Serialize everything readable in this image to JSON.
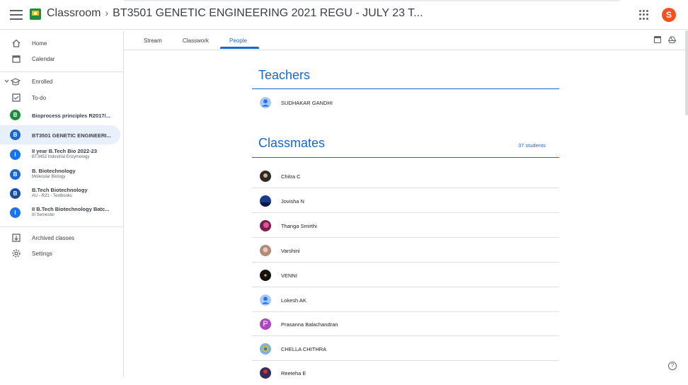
{
  "header": {
    "app_name": "Classroom",
    "separator": "›",
    "class_title": "BT3501 GENETIC ENGINEERING 2021 REGU - JULY 23 T...",
    "account_initial": "S"
  },
  "sidebar": {
    "home": "Home",
    "calendar": "Calendar",
    "enrolled": "Enrolled",
    "todo": "To-do",
    "classes": [
      {
        "initial": "B",
        "title": "Bioprocess principles R2017/...",
        "subtitle": "",
        "color": "#1e8e3e"
      },
      {
        "initial": "B",
        "title": "BT3501 GENETIC ENGINEERI...",
        "subtitle": "",
        "color": "#1967d2",
        "active": true
      },
      {
        "initial": "I",
        "title": "II year B.Tech Bio 2022-23",
        "subtitle": "BT3452 Industrial Enzymology",
        "color": "#1a73e8"
      },
      {
        "initial": "B",
        "title": "B. Biotechnology",
        "subtitle": "Molecular Biology",
        "color": "#1967d2"
      },
      {
        "initial": "B",
        "title": "B.Tech Biotechnology",
        "subtitle": "AU - R21 - Textbooks",
        "color": "#174ea6"
      },
      {
        "initial": "I",
        "title": "II B.Tech Biotechnology Batc...",
        "subtitle": "III Semester",
        "color": "#1a73e8"
      }
    ],
    "archived": "Archived classes",
    "settings": "Settings"
  },
  "tabs": {
    "stream": "Stream",
    "classwork": "Classwork",
    "people": "People"
  },
  "teachers": {
    "heading": "Teachers",
    "list": [
      {
        "name": "SUDHAKAR GANDHI",
        "avatar": "default"
      }
    ]
  },
  "classmates": {
    "heading": "Classmates",
    "count": "37 students",
    "list": [
      {
        "name": "Chitra C",
        "avatar": "photo",
        "color": "#2b2b2b"
      },
      {
        "name": "Jovisha N",
        "avatar": "photo",
        "color": "#1a3a8a"
      },
      {
        "name": "Thanga Smirthi",
        "avatar": "photo",
        "color": "#7a1f4a"
      },
      {
        "name": "Varshini",
        "avatar": "photo",
        "color": "#b08a7a"
      },
      {
        "name": "VENNI",
        "avatar": "photo",
        "color": "#111111"
      },
      {
        "name": "Lokesh AK",
        "avatar": "default"
      },
      {
        "name": "Prasanna Balachandran",
        "avatar": "letter",
        "letter": "P",
        "color": "#ab47bc"
      },
      {
        "name": "CHELLA CHITHRA",
        "avatar": "photo",
        "color": "#7fb3d5"
      },
      {
        "name": "Reeteha E",
        "avatar": "photo",
        "color": "#3a2a5a"
      }
    ]
  },
  "colors": {
    "accent": "#1967d2",
    "active_bg": "#e8f0fe"
  }
}
